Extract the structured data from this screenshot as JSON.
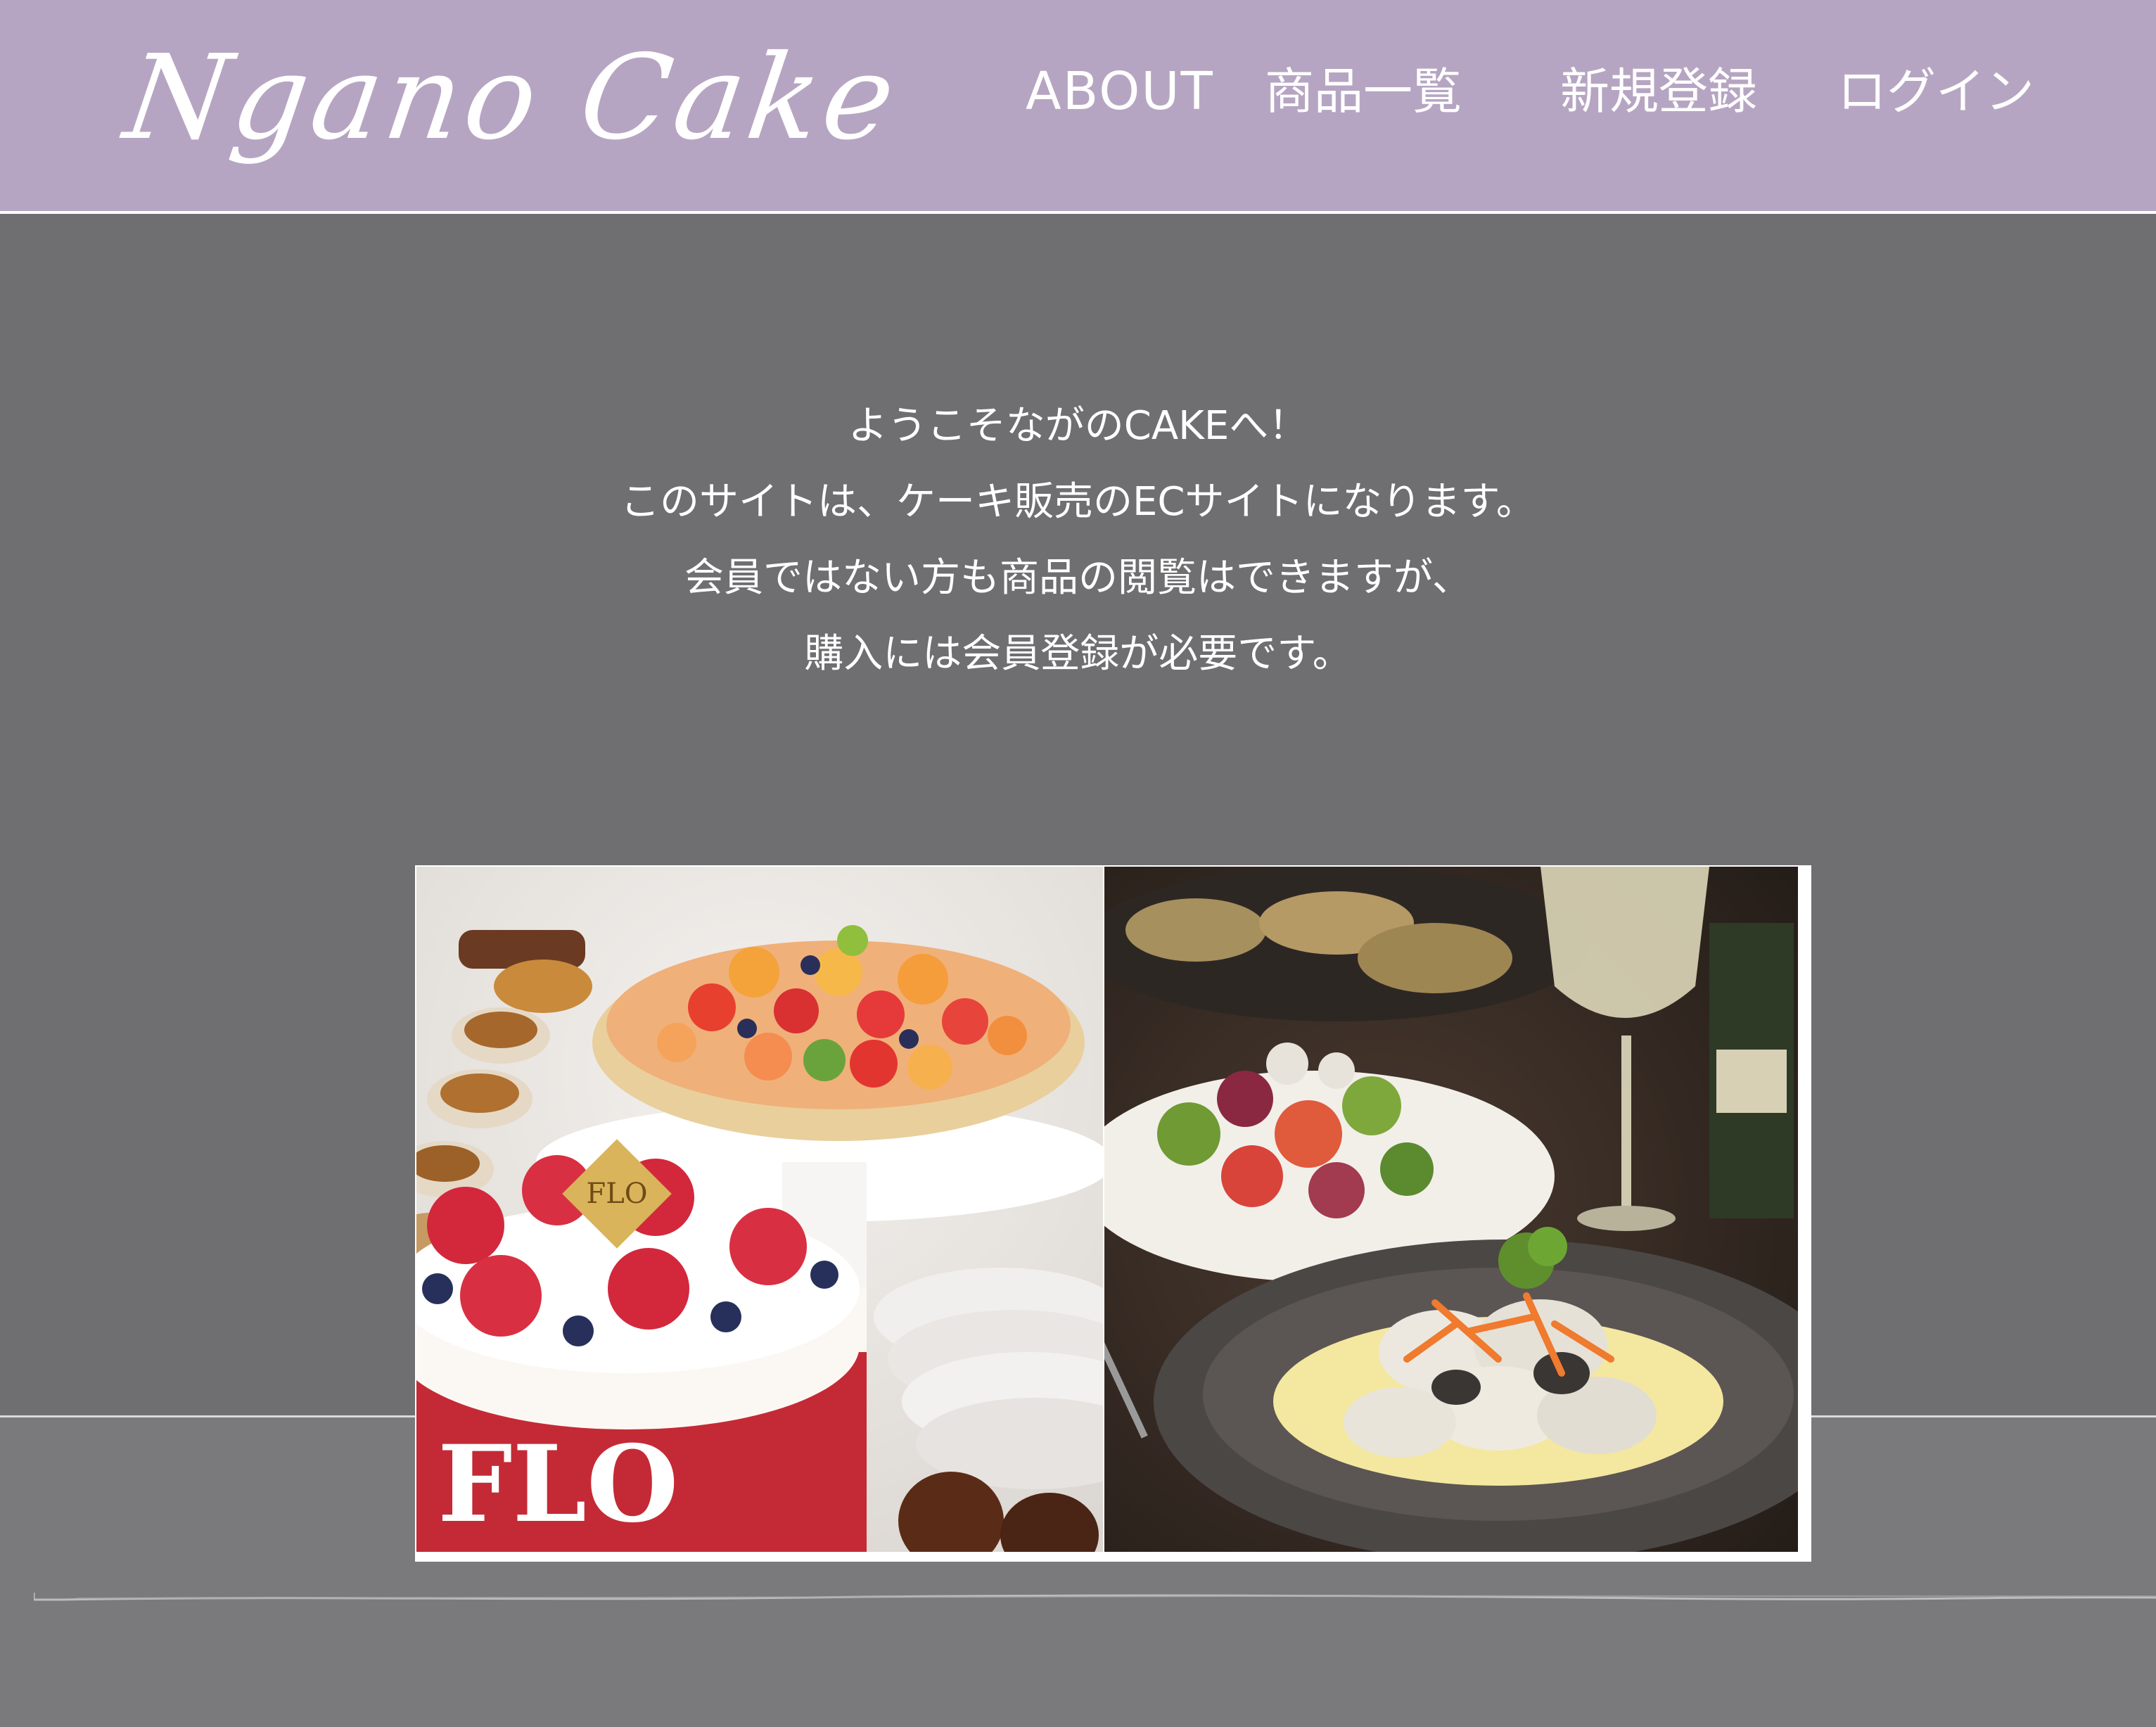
{
  "header": {
    "logo_text": "Ngano Cake",
    "background_color": "#b6a5c2",
    "nav": [
      {
        "label": "ABOUT"
      },
      {
        "label": "商品一覧"
      },
      {
        "label": "新規登録"
      },
      {
        "label": "ログイン"
      }
    ]
  },
  "welcome": {
    "lines": [
      "ようこそながのCAKEへ！",
      "このサイトは、ケーキ販売のECサイトになります。",
      "会員ではない方も商品の閲覧はできますが、",
      "購入には会員登録が必要です。"
    ]
  },
  "hero": {
    "images": [
      {
        "icon": "cake-photo",
        "logo_text": "FLO"
      },
      {
        "icon": "dish-photo"
      }
    ]
  },
  "colors": {
    "main_background": "#6f6e70",
    "lower_band": "#7a797b",
    "text": "#ffffff"
  }
}
